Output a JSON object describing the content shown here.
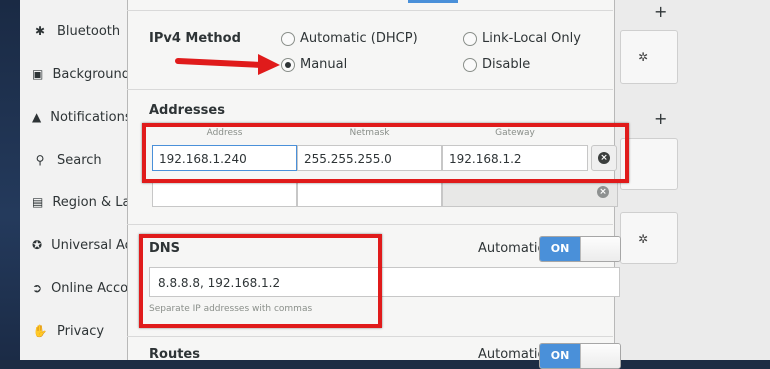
{
  "sidebar": {
    "items": [
      {
        "icon": "bluetooth-icon",
        "glyph": "✱",
        "label": "Bluetooth"
      },
      {
        "icon": "background-icon",
        "glyph": "▣",
        "label": "Background"
      },
      {
        "icon": "notifications-icon",
        "glyph": "▲",
        "label": "Notifications"
      },
      {
        "icon": "search-icon",
        "glyph": "⚲",
        "label": "Search"
      },
      {
        "icon": "region-icon",
        "glyph": "▤",
        "label": "Region & La"
      },
      {
        "icon": "universal-access-icon",
        "glyph": "✪",
        "label": "Universal Ac"
      },
      {
        "icon": "online-accounts-icon",
        "glyph": "➲",
        "label": "Online Accou"
      },
      {
        "icon": "privacy-icon",
        "glyph": "✋",
        "label": "Privacy"
      }
    ]
  },
  "ipv4": {
    "method_label": "IPv4 Method",
    "options": {
      "automatic": "Automatic (DHCP)",
      "link_local": "Link-Local Only",
      "manual": "Manual",
      "disable": "Disable"
    },
    "selected": "Manual"
  },
  "addresses": {
    "title": "Addresses",
    "headers": [
      "Address",
      "Netmask",
      "Gateway"
    ],
    "rows": [
      {
        "address": "192.168.1.240",
        "netmask": "255.255.255.0",
        "gateway": "192.168.1.2"
      },
      {
        "address": "",
        "netmask": "",
        "gateway": ""
      }
    ]
  },
  "dns": {
    "title": "DNS",
    "automatic_label": "Automatic",
    "switch_label": "ON",
    "value": "8.8.8.8, 192.168.1.2",
    "hint": "Separate IP addresses with commas"
  },
  "routes": {
    "title": "Routes",
    "automatic_label": "Automatic",
    "switch_label": "ON"
  },
  "right_panel": {
    "plus": "+",
    "gear": "✲"
  },
  "colors": {
    "accent": "#4a90d9",
    "annotation_red": "#e01b1b"
  }
}
